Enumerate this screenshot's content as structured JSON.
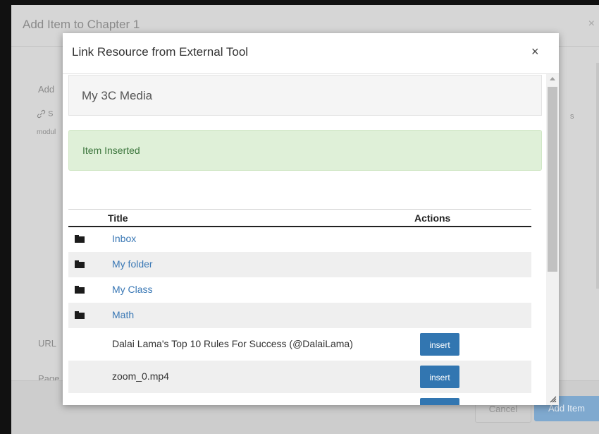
{
  "background_dialog": {
    "title": "Add Item to Chapter 1",
    "close_glyph": "×",
    "add_label": "Add",
    "link_fragment": "S",
    "module_fragment": "modul",
    "right_fragment": "s",
    "url_label": "URL",
    "page_label": "Page",
    "cancel_label": "Cancel",
    "add_item_label": "Add Item"
  },
  "modal": {
    "title": "Link Resource from External Tool",
    "close_glyph": "×",
    "tool_name": "My 3C Media",
    "alert_text": "Item Inserted",
    "table": {
      "headers": {
        "title": "Title",
        "actions": "Actions"
      },
      "folders": [
        {
          "name": "Inbox"
        },
        {
          "name": "My folder"
        },
        {
          "name": "My Class"
        },
        {
          "name": "Math"
        }
      ],
      "items": [
        {
          "title": "Dalai Lama's Top 10 Rules For Success (@DalaiLama)",
          "action": "insert"
        },
        {
          "title": "zoom_0.mp4",
          "action": "insert"
        }
      ]
    }
  },
  "icons": {
    "folder": "folder-icon",
    "link": "link-icon",
    "resize": "resize-grip-icon"
  },
  "colors": {
    "link": "#3a78b5",
    "insert_button": "#3276b1",
    "alert_bg": "#dff0d8",
    "alert_text": "#3c763d"
  }
}
